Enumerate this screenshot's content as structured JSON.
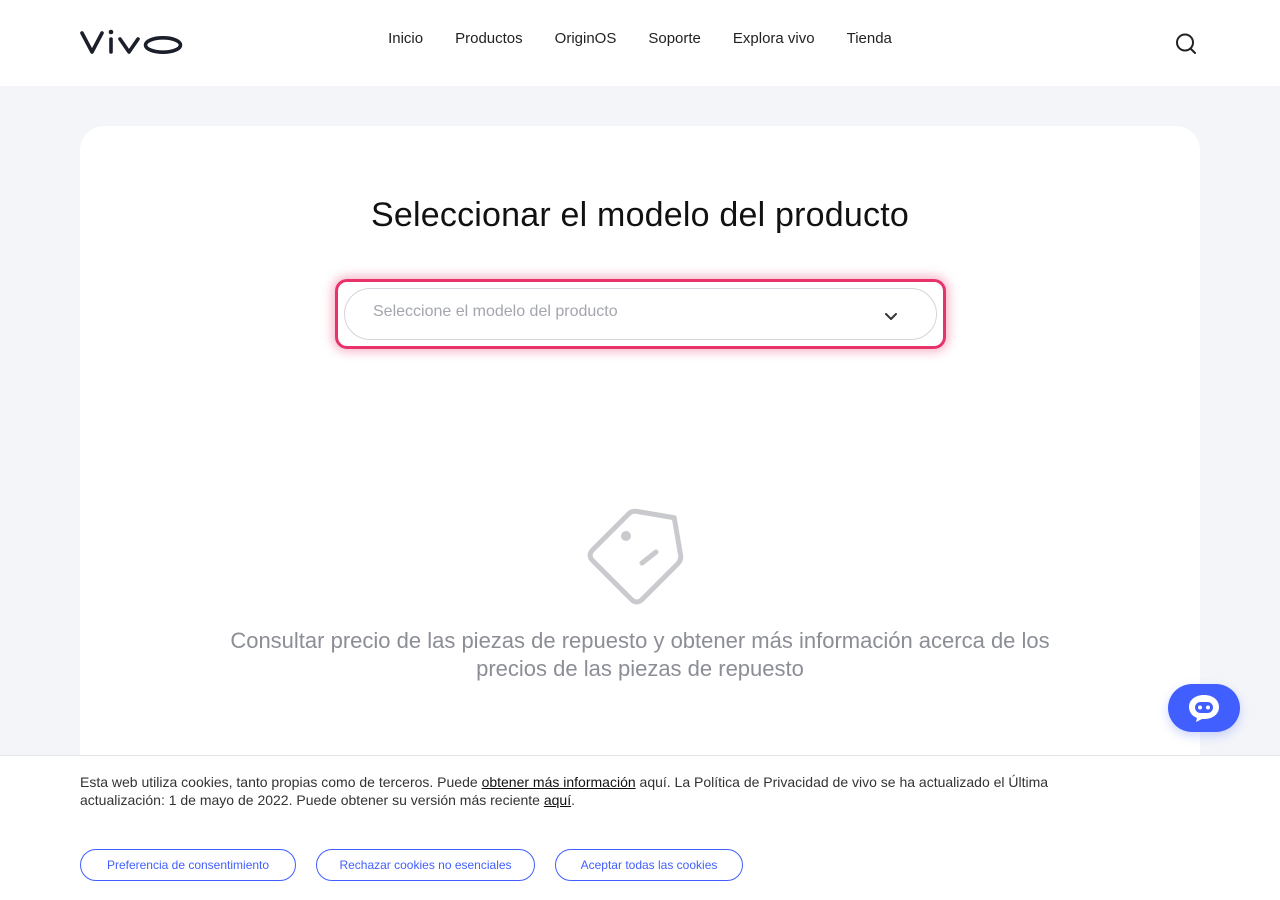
{
  "header": {
    "brand": "vivo",
    "nav": [
      "Inicio",
      "Productos",
      "OriginOS",
      "Soporte",
      "Explora vivo",
      "Tienda"
    ]
  },
  "main": {
    "title": "Seleccionar el modelo del producto",
    "select_placeholder": "Seleccione el modelo del producto",
    "empty_message": "Consultar precio de las piezas de repuesto y obtener más información acerca de los precios de las piezas de repuesto"
  },
  "cookie": {
    "text_1": "Esta web utiliza cookies, tanto propias como de terceros. Puede ",
    "link_1": "obtener más información",
    "text_2": " aquí. La Política de Privacidad de vivo se ha actualizado el Última actualización: 1 de mayo de 2022. Puede obtener su versión más reciente ",
    "link_2": "aquí",
    "text_3": ".",
    "buttons": [
      "Preferencia de consentimiento",
      "Rechazar cookies no esenciales",
      "Aceptar todas las cookies"
    ]
  },
  "colors": {
    "accent": "#415fff",
    "highlight": "#e8336a",
    "background": "#f4f5f9"
  },
  "icons": {
    "search": "search-icon",
    "chevron": "chevron-down-icon",
    "empty": "tag-face-icon",
    "chat": "chatbot-icon"
  }
}
